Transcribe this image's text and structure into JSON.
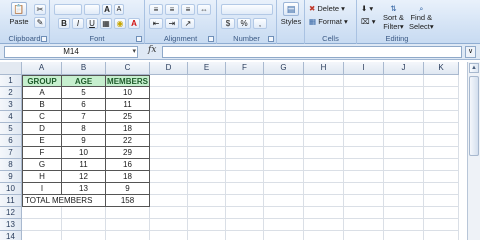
{
  "ribbon": {
    "clipboard": {
      "label": "Clipboard",
      "paste_label": "Paste"
    },
    "font": {
      "label": "Font",
      "bold": "B",
      "italic": "I",
      "underline": "U",
      "grow": "A",
      "shrink": "A",
      "font_color": "A"
    },
    "alignment": {
      "label": "Alignment"
    },
    "number": {
      "label": "Number",
      "percent": "%",
      "comma": ","
    },
    "styles": {
      "label": "Styles"
    },
    "cells": {
      "label": "Cells",
      "delete_label": "Delete",
      "format_label": "Format"
    },
    "editing": {
      "label": "Editing",
      "sort_filter": "Sort &",
      "sort_filter_2": "Filter",
      "find_select": "Find &",
      "find_select_2": "Select"
    }
  },
  "formula_bar": {
    "name_box": "M14",
    "fx": "fx",
    "value": ""
  },
  "columns": [
    "A",
    "B",
    "C",
    "D",
    "E",
    "F",
    "G",
    "H",
    "I",
    "J",
    "K"
  ],
  "selected_column": "M",
  "rows": [
    "1",
    "2",
    "3",
    "4",
    "5",
    "6",
    "7",
    "8",
    "9",
    "10",
    "11",
    "12",
    "13",
    "14"
  ],
  "table": {
    "headers": [
      "GROUP",
      "AGE",
      "MEMBERS"
    ],
    "data": [
      [
        "A",
        "5",
        "10"
      ],
      [
        "B",
        "6",
        "11"
      ],
      [
        "C",
        "7",
        "25"
      ],
      [
        "D",
        "8",
        "18"
      ],
      [
        "E",
        "9",
        "22"
      ],
      [
        "F",
        "10",
        "29"
      ],
      [
        "G",
        "11",
        "16"
      ],
      [
        "H",
        "12",
        "18"
      ],
      [
        "I",
        "13",
        "9"
      ]
    ],
    "total_label": "TOTAL MEMBERS",
    "total_value": "158"
  },
  "colors": {
    "header_fill": "#c6efce",
    "header_text": "#1e5c2a",
    "ribbon": "#d4e3f5"
  }
}
